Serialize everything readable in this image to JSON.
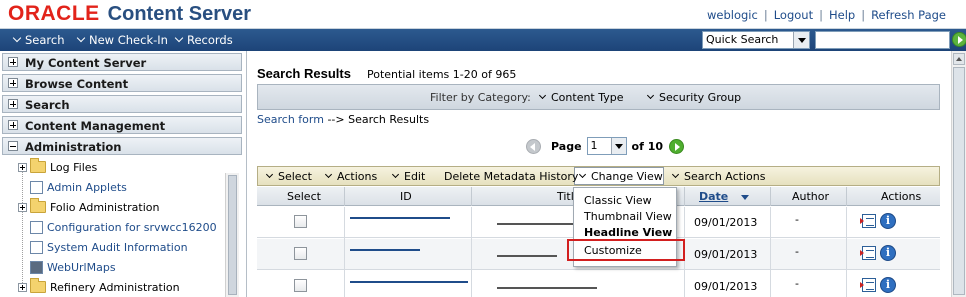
{
  "header": {
    "brand": "ORACLE",
    "product": "Content Server",
    "links": [
      "weblogic",
      "Logout",
      "Help",
      "Refresh Page"
    ],
    "separator": "|"
  },
  "nav": {
    "items": [
      "Search",
      "New Check-In",
      "Records"
    ],
    "quick_search_selected": "Quick Search",
    "quick_search_value": ""
  },
  "sidebar": {
    "sections": [
      {
        "label": "My Content Server",
        "expanded": false
      },
      {
        "label": "Browse Content",
        "expanded": false
      },
      {
        "label": "Search",
        "expanded": false
      },
      {
        "label": "Content Management",
        "expanded": false
      },
      {
        "label": "Administration",
        "expanded": true
      }
    ],
    "admin_items": [
      {
        "label": "Log Files",
        "icon": "folder-icon",
        "expandable": true
      },
      {
        "label": "Admin Applets",
        "icon": "page-icon",
        "expandable": false
      },
      {
        "label": "Folio Administration",
        "icon": "folder-icon",
        "expandable": true
      },
      {
        "label": "Configuration for srvwcc16200",
        "icon": "page-icon",
        "expandable": false
      },
      {
        "label": "System Audit Information",
        "icon": "page-icon",
        "expandable": false
      },
      {
        "label": "WebUrlMaps",
        "icon": "page-icon",
        "expandable": false
      },
      {
        "label": "Refinery Administration",
        "icon": "folder-icon",
        "expandable": true
      }
    ]
  },
  "main": {
    "title": "Search Results",
    "count_text": "Potential items 1-20 of 965",
    "filter": {
      "label": "Filter by Category:",
      "items": [
        "Content Type",
        "Security Group"
      ]
    },
    "breadcrumb": {
      "link": "Search form",
      "rest": "--> Search Results"
    },
    "pager": {
      "label": "Page",
      "current": "1",
      "of_text": "of 10"
    },
    "toolbar": {
      "select": "Select",
      "actions": "Actions",
      "edit": "Edit",
      "delete_history": "Delete Metadata History",
      "change_view": "Change View",
      "search_actions": "Search Actions"
    },
    "columns": [
      "Select",
      "ID",
      "Title",
      "Date",
      "Author",
      "Actions"
    ],
    "rows": [
      {
        "date": "09/01/2013",
        "author": "-"
      },
      {
        "date": "09/01/2013",
        "author": "-"
      },
      {
        "date": "09/01/2013",
        "author": "-"
      }
    ],
    "change_view_menu": [
      "Classic View",
      "Thumbnail View",
      "Headline View",
      "Customize"
    ],
    "highlight_color": "#d21f1f"
  }
}
